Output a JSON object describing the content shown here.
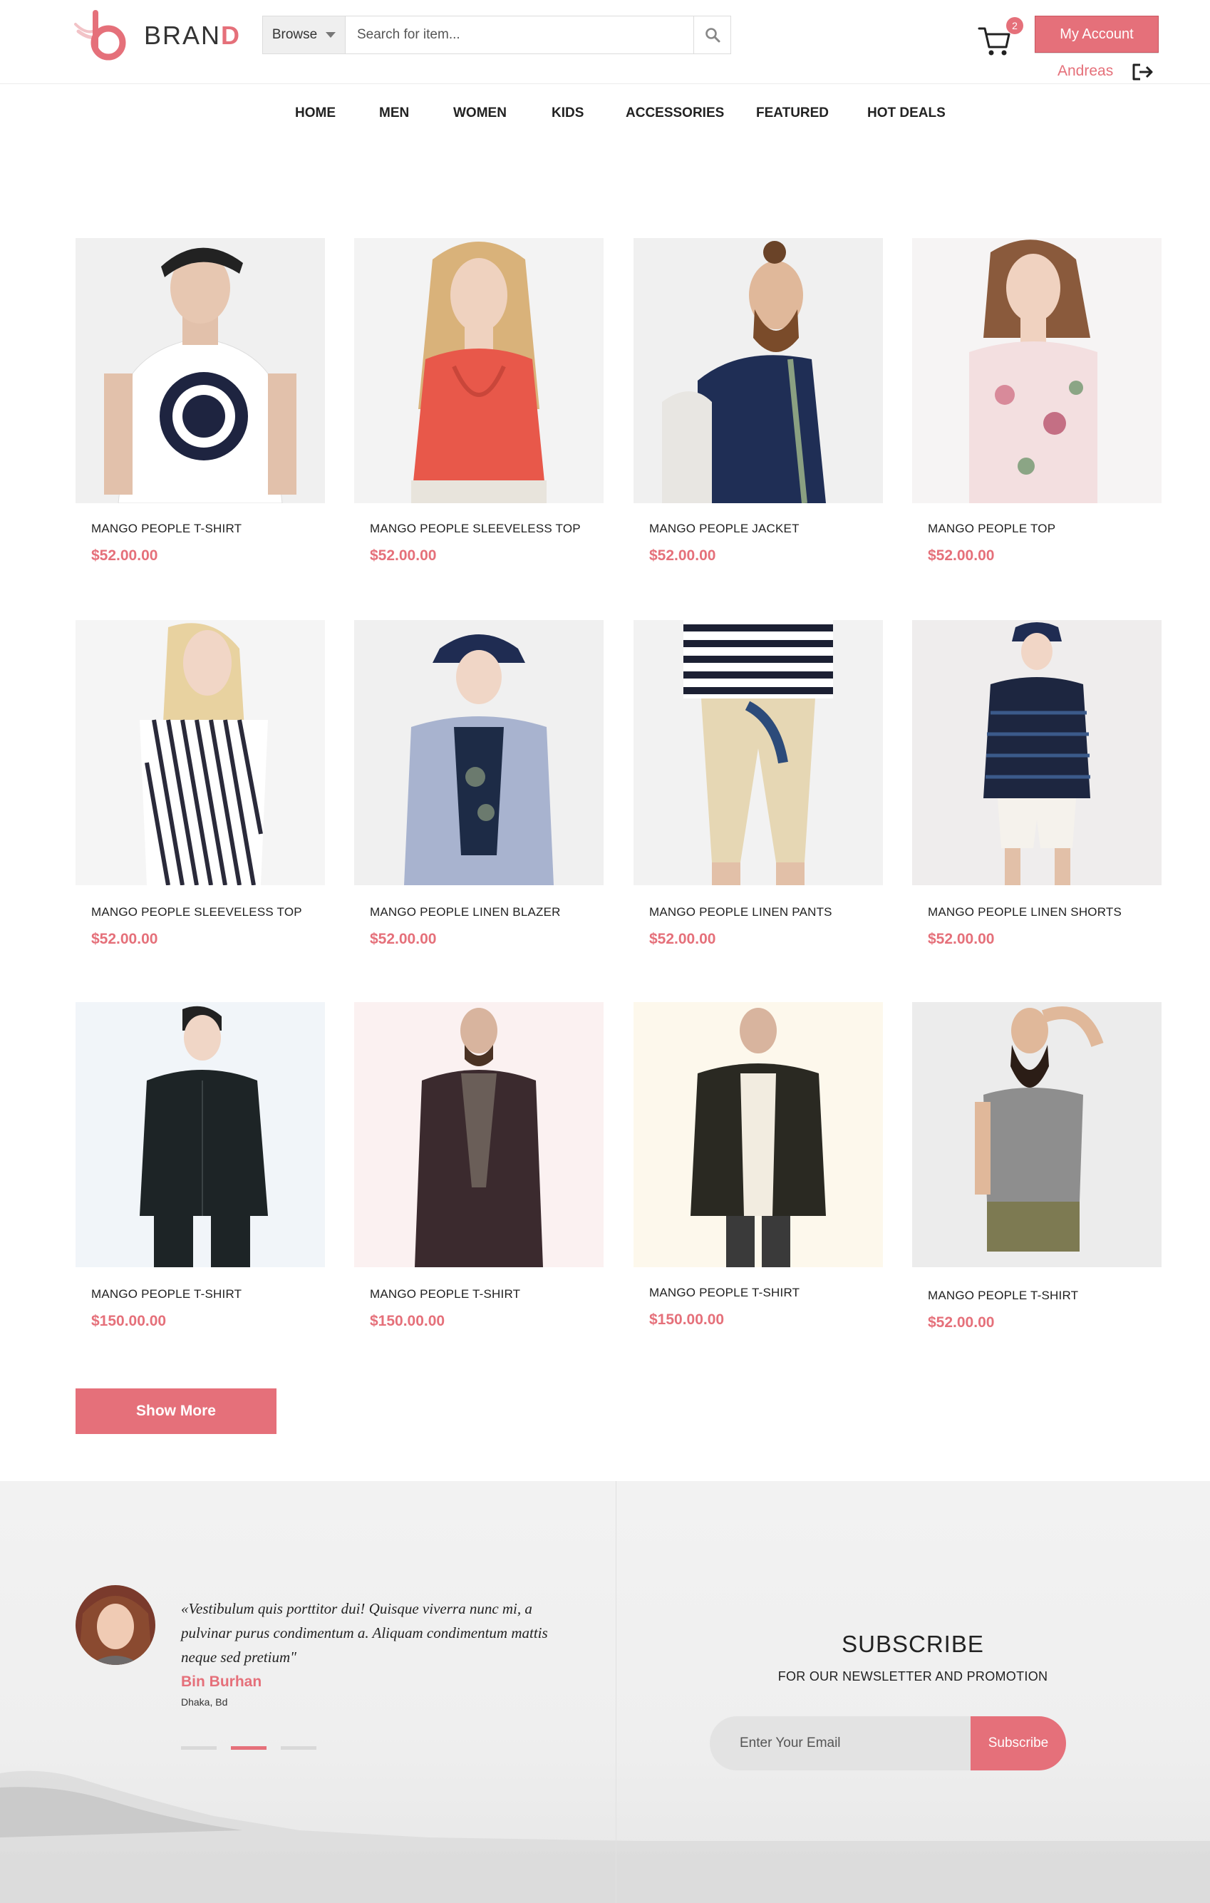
{
  "brand": {
    "name_main": "BRAN",
    "name_accent": "D"
  },
  "search": {
    "browse_label": "Browse",
    "placeholder": "Search for item..."
  },
  "cart": {
    "count": "2"
  },
  "account": {
    "button_label": "My Account",
    "user_name": "Andreas"
  },
  "nav": {
    "items": [
      {
        "label": "HOME"
      },
      {
        "label": "MEN"
      },
      {
        "label": "WOMEN"
      },
      {
        "label": "KIDS"
      },
      {
        "label": "ACCESSORIES"
      },
      {
        "label": "FEATURED"
      },
      {
        "label": "HOT DEALS"
      }
    ]
  },
  "products": [
    {
      "name": "MANGO PEOPLE T-SHIRT",
      "price": "$52.00.00"
    },
    {
      "name": "MANGO PEOPLE SLEEVELESS TOP",
      "price": "$52.00.00"
    },
    {
      "name": "MANGO PEOPLE JACKET",
      "price": "$52.00.00"
    },
    {
      "name": "MANGO PEOPLE TOP",
      "price": "$52.00.00"
    },
    {
      "name": "MANGO PEOPLE SLEEVELESS TOP",
      "price": "$52.00.00"
    },
    {
      "name": "MANGO PEOPLE LINEN BLAZER",
      "price": "$52.00.00"
    },
    {
      "name": "MANGO PEOPLE LINEN PANTS",
      "price": "$52.00.00"
    },
    {
      "name": "MANGO PEOPLE LINEN SHORTS",
      "price": "$52.00.00"
    },
    {
      "name": "MANGO PEOPLE T-SHIRT",
      "price": "$150.00.00"
    },
    {
      "name": "MANGO PEOPLE T-SHIRT",
      "price": "$150.00.00"
    },
    {
      "name": "MANGO PEOPLE T-SHIRT",
      "price": "$150.00.00"
    },
    {
      "name": "MANGO PEOPLE T-SHIRT",
      "price": "$52.00.00"
    }
  ],
  "show_more_label": "Show More",
  "testimonial": {
    "quote": "«Vestibulum quis porttitor dui! Quisque viverra nunc mi, a pulvinar purus condimentum a. Aliquam condimentum mattis neque sed pretium\"",
    "author": "Bin Burhan",
    "location": "Dhaka, Bd"
  },
  "subscribe": {
    "title": "SUBSCRIBE",
    "subtitle": "FOR OUR NEWSLETTER AND PROMOTION",
    "placeholder": "Enter Your Email",
    "button_label": "Subscribe"
  },
  "colors": {
    "accent": "#e5707a"
  }
}
